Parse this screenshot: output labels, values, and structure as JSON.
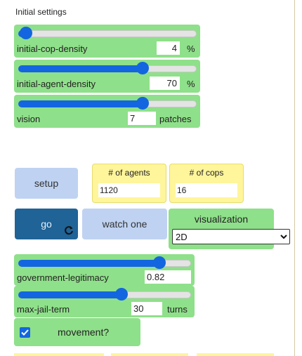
{
  "section_title": "Initial settings",
  "sliders": {
    "cop_density": {
      "label": "initial-cop-density",
      "value": "4",
      "unit": "%",
      "level": 0.04
    },
    "agent_density": {
      "label": "initial-agent-density",
      "value": "70",
      "unit": "%",
      "level": 0.7
    },
    "vision": {
      "label": "vision",
      "value": "7",
      "unit": "patches",
      "level": 0.7
    },
    "legitimacy": {
      "label": "government-legitimacy",
      "value": "0.82",
      "unit": "",
      "level": 0.82
    },
    "jail_term": {
      "label": "max-jail-term",
      "value": "30",
      "unit": "turns",
      "level": 0.6
    }
  },
  "buttons": {
    "setup": "setup",
    "go": "go",
    "go_icon": "forever-loop-icon",
    "watch_one": "watch one"
  },
  "monitors": {
    "agents": {
      "title": "# of agents",
      "value": "1120"
    },
    "cops": {
      "title": "# of cops",
      "value": "16"
    }
  },
  "chooser": {
    "label": "visualization",
    "selected": "2D",
    "options": [
      "2D"
    ]
  },
  "switch": {
    "label": "movement?",
    "checked": true
  },
  "colors": {
    "widget_green": "#8fe08a",
    "button_light": "#bfd2f2",
    "button_dark": "#1f6397",
    "monitor_yellow": "#fff59b",
    "accent_blue": "#1366e0"
  }
}
